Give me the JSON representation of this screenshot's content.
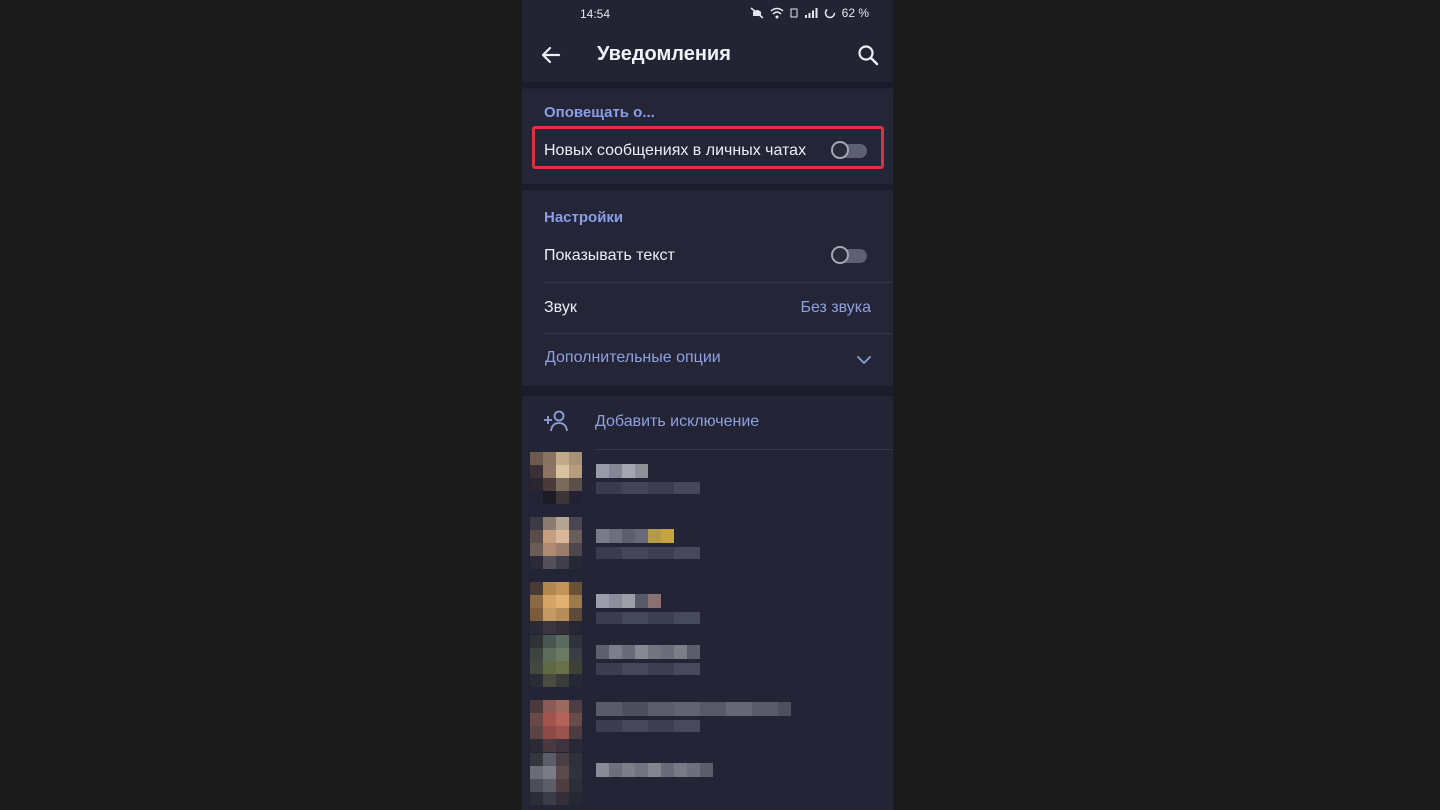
{
  "status": {
    "time": "14:54",
    "battery": "62 %"
  },
  "header": {
    "title": "Уведомления",
    "back_icon": "arrow-left-icon",
    "search_icon": "search-icon"
  },
  "notify_section": {
    "heading": "Оповещать о...",
    "private_messages_label": "Новых сообщениях в личных чатах",
    "private_messages_enabled": false
  },
  "settings_section": {
    "heading": "Настройки",
    "show_text_label": "Показывать текст",
    "show_text_enabled": false,
    "sound_label": "Звук",
    "sound_value": "Без звука",
    "more_options_label": "Дополнительные опции"
  },
  "exceptions": {
    "add_label": "Добавить исключение",
    "add_icon": "add-user-icon",
    "contacts_count_visible": 6
  },
  "colors": {
    "accent": "#8fa0dd",
    "highlight": "#e0303f",
    "background": "#242638"
  }
}
